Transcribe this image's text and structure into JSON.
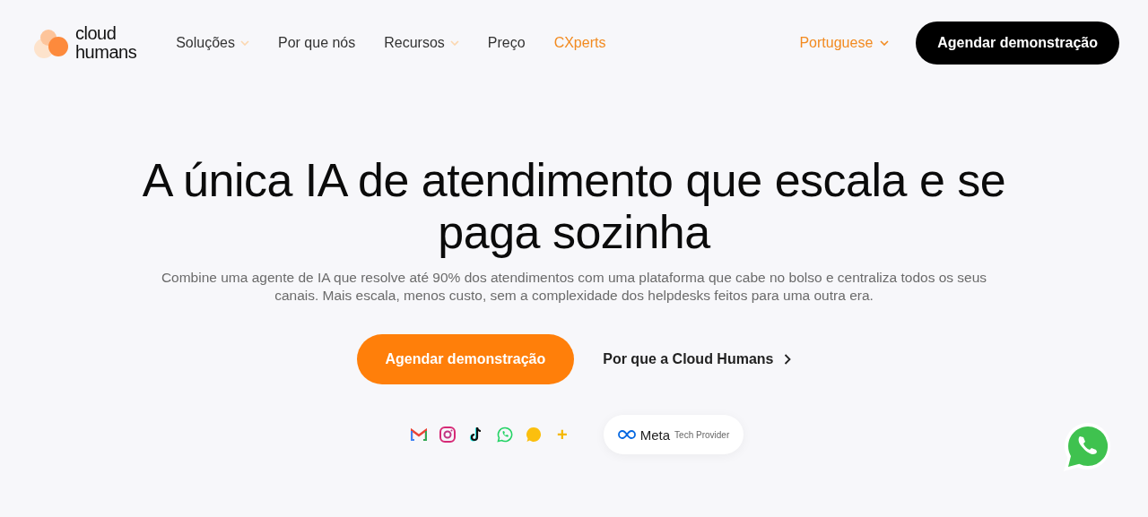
{
  "logo": {
    "line_1": "cloud",
    "line_2": "humans"
  },
  "nav": [
    {
      "label": "Soluções",
      "has_menu": true,
      "highlighted": false
    },
    {
      "label": "Por que nós",
      "has_menu": false,
      "highlighted": false
    },
    {
      "label": "Recursos",
      "has_menu": true,
      "highlighted": false
    },
    {
      "label": "Preço",
      "has_menu": false,
      "highlighted": false
    },
    {
      "label": "CXperts",
      "has_menu": false,
      "highlighted": true
    }
  ],
  "language": "Portuguese",
  "header_button": "Agendar demonstração",
  "hero": {
    "title": "A única IA de atendimento que escala e se paga sozinha",
    "subtitle": "Combine uma agente de IA que resolve até 90% dos atendimentos com uma plataforma que cabe no bolso e centraliza todos os seus canais. Mais escala, menos custo, sem a complexidade dos helpdesks feitos para uma outra era.",
    "primary_button": "Agendar demonstração",
    "secondary_link": "Por que a Cloud Humans"
  },
  "channels": [
    {
      "kind": "gmail"
    },
    {
      "kind": "instagram"
    },
    {
      "kind": "tiktok"
    },
    {
      "kind": "whatsapp"
    },
    {
      "kind": "chat"
    },
    {
      "kind": "more",
      "label": "+"
    }
  ],
  "meta_badge": {
    "brand": "Meta",
    "caption": "Tech Provider"
  }
}
